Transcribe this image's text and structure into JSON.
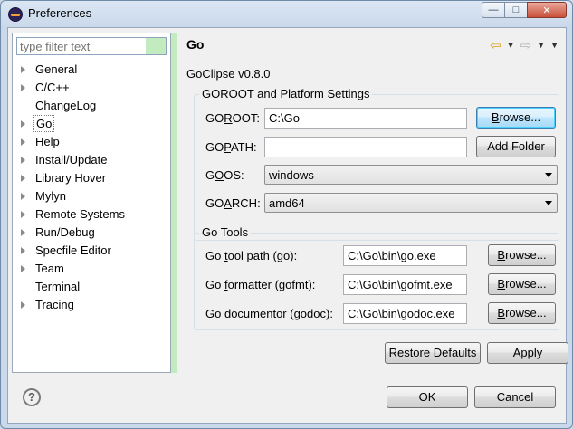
{
  "window": {
    "title": "Preferences"
  },
  "filter": {
    "placeholder": "type filter text"
  },
  "tree": {
    "items": [
      {
        "label": "General",
        "expandable": true
      },
      {
        "label": "C/C++",
        "expandable": true
      },
      {
        "label": "ChangeLog",
        "expandable": false
      },
      {
        "label": "Go",
        "expandable": true,
        "selected": true
      },
      {
        "label": "Help",
        "expandable": true
      },
      {
        "label": "Install/Update",
        "expandable": true
      },
      {
        "label": "Library Hover",
        "expandable": true
      },
      {
        "label": "Mylyn",
        "expandable": true
      },
      {
        "label": "Remote Systems",
        "expandable": true
      },
      {
        "label": "Run/Debug",
        "expandable": true
      },
      {
        "label": "Specfile Editor",
        "expandable": true
      },
      {
        "label": "Team",
        "expandable": true
      },
      {
        "label": "Terminal",
        "expandable": false
      },
      {
        "label": "Tracing",
        "expandable": true
      }
    ]
  },
  "page": {
    "title": "Go",
    "version": "GoClipse v0.8.0"
  },
  "goroot_group": {
    "title": "GOROOT and Platform Settings",
    "goroot_label_a": "GO",
    "goroot_label_u": "R",
    "goroot_label_b": "OOT:",
    "goroot_value": "C:\\Go",
    "browse_a": "",
    "browse_u": "B",
    "browse_b": "rowse...",
    "gopath_label_a": "GO",
    "gopath_label_u": "P",
    "gopath_label_b": "ATH:",
    "gopath_value": "",
    "add_folder": "Add Folder",
    "goos_label_a": "G",
    "goos_label_u": "O",
    "goos_label_b": "OS:",
    "goos_value": "windows",
    "goarch_label_a": "GO",
    "goarch_label_u": "A",
    "goarch_label_b": "RCH:",
    "goarch_value": "amd64"
  },
  "tools_group": {
    "title": "Go Tools",
    "tool_label_a": "Go ",
    "tool_label_u": "t",
    "tool_label_b": "ool path (go):",
    "tool_value": "C:\\Go\\bin\\go.exe",
    "fmt_label_a": "Go ",
    "fmt_label_u": "f",
    "fmt_label_b": "ormatter (gofmt):",
    "fmt_value": "C:\\Go\\bin\\gofmt.exe",
    "doc_label_a": "Go ",
    "doc_label_u": "d",
    "doc_label_b": "ocumentor (godoc):",
    "doc_value": "C:\\Go\\bin\\godoc.exe",
    "browse_a": "",
    "browse_u": "B",
    "browse_b": "rowse..."
  },
  "actions": {
    "restore_a": "Restore ",
    "restore_u": "D",
    "restore_b": "efaults",
    "apply_a": "",
    "apply_u": "A",
    "apply_b": "pply",
    "ok": "OK",
    "cancel": "Cancel"
  },
  "help_glyph": "?"
}
